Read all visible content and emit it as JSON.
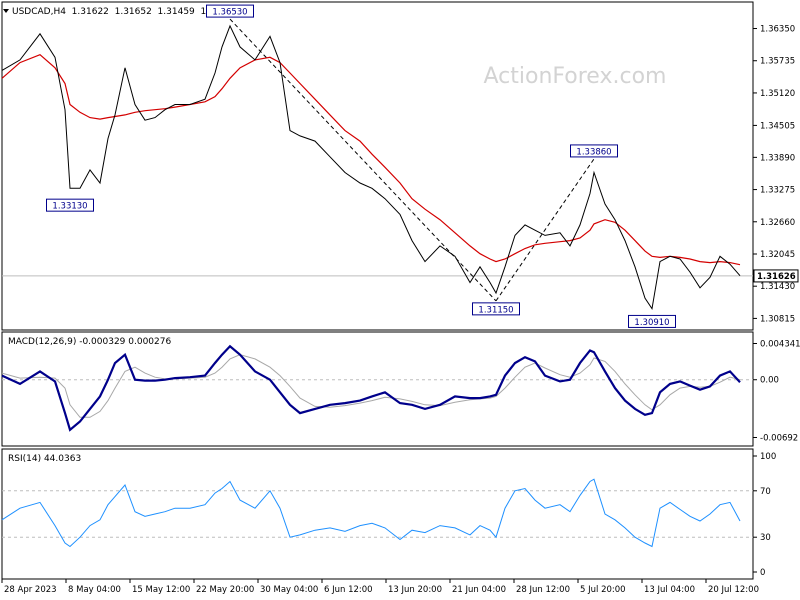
{
  "header": {
    "symbol_line": "USDCAD,H4  1.31622  1.31652  1.31459  1.31626"
  },
  "watermark": "ActionForex.com",
  "colors": {
    "price": "#000000",
    "ma": "#d40000",
    "macd": "#00008b",
    "signal": "#a8a8a8",
    "rsi": "#1e90ff",
    "grid": "#bdbdbd"
  },
  "chart_data": [
    {
      "type": "line",
      "name": "price",
      "title": "USDCAD,H4  1.31622  1.31652  1.31459  1.31626",
      "x_labels": [
        "28 Apr 2023",
        "8 May 04:00",
        "15 May 12:00",
        "22 May 20:00",
        "30 May 04:00",
        "6 Jun 12:00",
        "13 Jun 20:00",
        "21 Jun 04:00",
        "28 Jun 12:00",
        "5 Jul 20:00",
        "13 Jul 04:00",
        "20 Jul 12:00"
      ],
      "y_ticks": [
        1.3635,
        1.35735,
        1.3512,
        1.345,
        1.3389,
        1.33275,
        1.3266,
        1.32045,
        1.3143,
        1.30815
      ],
      "y_tick_labels": [
        "1.36350",
        "1.35735",
        "1.35120",
        "1.34505",
        "1.33890",
        "1.33275",
        "1.32660",
        "1.32045",
        "1.31430",
        "1.30815"
      ],
      "ylim": [
        1.3067,
        1.3678
      ],
      "current": 1.31626,
      "current_label": "1.31626",
      "annotations": [
        {
          "label": "1.36530",
          "value": 1.3653,
          "t": 230
        },
        {
          "label": "1.33130",
          "value": 1.3313,
          "t": 70
        },
        {
          "label": "1.33860",
          "value": 1.3386,
          "t": 594
        },
        {
          "label": "1.31150",
          "value": 1.3115,
          "t": 496
        },
        {
          "label": "1.30910",
          "value": 1.3091,
          "t": 652
        }
      ],
      "trendlines": [
        [
          230,
          1.3653,
          496,
          1.3115
        ],
        [
          496,
          1.3115,
          594,
          1.3386
        ]
      ],
      "x": [
        2,
        20,
        40,
        55,
        65,
        70,
        80,
        90,
        100,
        108,
        115,
        125,
        135,
        145,
        155,
        165,
        175,
        190,
        205,
        215,
        222,
        230,
        240,
        255,
        270,
        280,
        290,
        300,
        315,
        330,
        345,
        360,
        372,
        385,
        400,
        412,
        425,
        440,
        455,
        470,
        480,
        490,
        496,
        505,
        515,
        525,
        535,
        545,
        560,
        570,
        580,
        590,
        594,
        605,
        615,
        625,
        635,
        645,
        652,
        660,
        670,
        680,
        690,
        700,
        710,
        720,
        730,
        740
      ],
      "close": [
        1.3555,
        1.3575,
        1.3625,
        1.358,
        1.348,
        1.333,
        1.333,
        1.3365,
        1.334,
        1.3425,
        1.347,
        1.356,
        1.349,
        1.346,
        1.3465,
        1.348,
        1.349,
        1.349,
        1.35,
        1.355,
        1.36,
        1.364,
        1.36,
        1.3575,
        1.362,
        1.357,
        1.344,
        1.343,
        1.342,
        1.339,
        1.336,
        1.334,
        1.333,
        1.331,
        1.328,
        1.323,
        1.319,
        1.322,
        1.32,
        1.315,
        1.318,
        1.315,
        1.313,
        1.318,
        1.324,
        1.326,
        1.325,
        1.324,
        1.3245,
        1.322,
        1.326,
        1.332,
        1.336,
        1.33,
        1.327,
        1.323,
        1.318,
        1.312,
        1.31,
        1.319,
        1.32,
        1.3195,
        1.317,
        1.314,
        1.316,
        1.32,
        1.3185,
        1.3163
      ],
      "ma": [
        1.354,
        1.357,
        1.3585,
        1.356,
        1.353,
        1.349,
        1.3475,
        1.3465,
        1.3462,
        1.3465,
        1.3467,
        1.347,
        1.3475,
        1.3478,
        1.348,
        1.3482,
        1.3485,
        1.349,
        1.3495,
        1.3505,
        1.352,
        1.354,
        1.356,
        1.3575,
        1.358,
        1.357,
        1.355,
        1.353,
        1.35,
        1.347,
        1.344,
        1.342,
        1.3395,
        1.337,
        1.334,
        1.331,
        1.329,
        1.327,
        1.3245,
        1.322,
        1.3205,
        1.3195,
        1.319,
        1.3195,
        1.3205,
        1.3215,
        1.3222,
        1.3225,
        1.3228,
        1.323,
        1.3235,
        1.325,
        1.3262,
        1.327,
        1.3265,
        1.325,
        1.323,
        1.321,
        1.32,
        1.3198,
        1.32,
        1.3198,
        1.3195,
        1.319,
        1.3188,
        1.319,
        1.3188,
        1.3184
      ]
    },
    {
      "type": "line",
      "name": "macd",
      "title": "MACD(12,26,9) -0.000329 0.000276",
      "y_tick_labels": [
        "0.004341",
        "0.00",
        "-0.00692"
      ],
      "y_ticks": [
        0.004341,
        0.0,
        -0.00692
      ],
      "ylim": [
        -0.0077,
        0.005
      ],
      "x": [
        2,
        20,
        40,
        55,
        65,
        70,
        80,
        90,
        100,
        108,
        115,
        125,
        135,
        145,
        155,
        165,
        175,
        190,
        205,
        215,
        222,
        230,
        240,
        255,
        270,
        280,
        290,
        300,
        315,
        330,
        345,
        360,
        372,
        385,
        400,
        412,
        425,
        440,
        455,
        470,
        480,
        490,
        496,
        505,
        515,
        525,
        535,
        545,
        560,
        570,
        580,
        590,
        594,
        605,
        615,
        625,
        635,
        645,
        652,
        660,
        670,
        680,
        690,
        700,
        710,
        720,
        730,
        740
      ],
      "macd": [
        0.0005,
        -0.0005,
        0.001,
        -0.0002,
        -0.004,
        -0.006,
        -0.005,
        -0.0035,
        -0.002,
        0.0,
        0.002,
        0.003,
        0.0,
        -0.0001,
        -0.0001,
        0.0,
        0.0002,
        0.0003,
        0.0005,
        0.002,
        0.003,
        0.004,
        0.003,
        0.001,
        0.0,
        -0.0015,
        -0.003,
        -0.004,
        -0.0035,
        -0.003,
        -0.0028,
        -0.0025,
        -0.002,
        -0.0015,
        -0.0028,
        -0.003,
        -0.0035,
        -0.003,
        -0.002,
        -0.0022,
        -0.0022,
        -0.002,
        -0.0018,
        0.0005,
        0.002,
        0.0027,
        0.0022,
        0.0005,
        -0.0002,
        0.0,
        0.002,
        0.0035,
        0.0033,
        0.001,
        -0.001,
        -0.0025,
        -0.0035,
        -0.0042,
        -0.004,
        -0.0015,
        -0.0005,
        -0.0002,
        -0.0007,
        -0.0012,
        -0.0008,
        0.0005,
        0.001,
        -0.0003
      ],
      "signal": [
        0.0008,
        0.0002,
        0.0003,
        0.0002,
        -0.001,
        -0.003,
        -0.0045,
        -0.0045,
        -0.0038,
        -0.0025,
        -0.001,
        0.001,
        0.0015,
        0.0008,
        0.0003,
        0.0001,
        0.0001,
        0.0002,
        0.0003,
        0.0008,
        0.0015,
        0.0025,
        0.003,
        0.0025,
        0.0015,
        0.0005,
        -0.0008,
        -0.0022,
        -0.0032,
        -0.0033,
        -0.0031,
        -0.0028,
        -0.0025,
        -0.0021,
        -0.0023,
        -0.0026,
        -0.003,
        -0.0031,
        -0.0027,
        -0.0024,
        -0.0023,
        -0.0022,
        -0.002,
        -0.001,
        0.0003,
        0.0015,
        0.002,
        0.0014,
        0.0006,
        0.0003,
        0.0008,
        0.0018,
        0.0026,
        0.0022,
        0.001,
        -0.0005,
        -0.0018,
        -0.003,
        -0.0036,
        -0.003,
        -0.0018,
        -0.001,
        -0.0008,
        -0.0009,
        -0.0008,
        -0.0003,
        0.0003,
        0.0
      ]
    },
    {
      "type": "line",
      "name": "rsi",
      "title": "RSI(14) 44.0363",
      "y_tick_labels": [
        "100",
        "70",
        "30",
        "0"
      ],
      "y_ticks": [
        100,
        70,
        30,
        0
      ],
      "levels": [
        70,
        30
      ],
      "ylim": [
        0,
        100
      ],
      "x": [
        2,
        20,
        40,
        55,
        65,
        70,
        80,
        90,
        100,
        108,
        115,
        125,
        135,
        145,
        155,
        165,
        175,
        190,
        205,
        215,
        222,
        230,
        240,
        255,
        270,
        280,
        290,
        300,
        315,
        330,
        345,
        360,
        372,
        385,
        400,
        412,
        425,
        440,
        455,
        470,
        480,
        490,
        496,
        505,
        515,
        525,
        535,
        545,
        560,
        570,
        580,
        590,
        594,
        605,
        615,
        625,
        635,
        645,
        652,
        660,
        670,
        680,
        690,
        700,
        710,
        720,
        730,
        740
      ],
      "rsi": [
        45,
        55,
        60,
        40,
        25,
        22,
        30,
        40,
        45,
        58,
        65,
        75,
        52,
        48,
        50,
        52,
        55,
        55,
        58,
        68,
        72,
        78,
        62,
        55,
        70,
        55,
        30,
        32,
        36,
        38,
        35,
        40,
        42,
        38,
        28,
        36,
        34,
        40,
        38,
        32,
        40,
        36,
        30,
        55,
        70,
        72,
        62,
        55,
        58,
        52,
        66,
        78,
        80,
        50,
        45,
        38,
        30,
        25,
        22,
        55,
        60,
        54,
        48,
        44,
        50,
        58,
        60,
        44
      ]
    }
  ]
}
